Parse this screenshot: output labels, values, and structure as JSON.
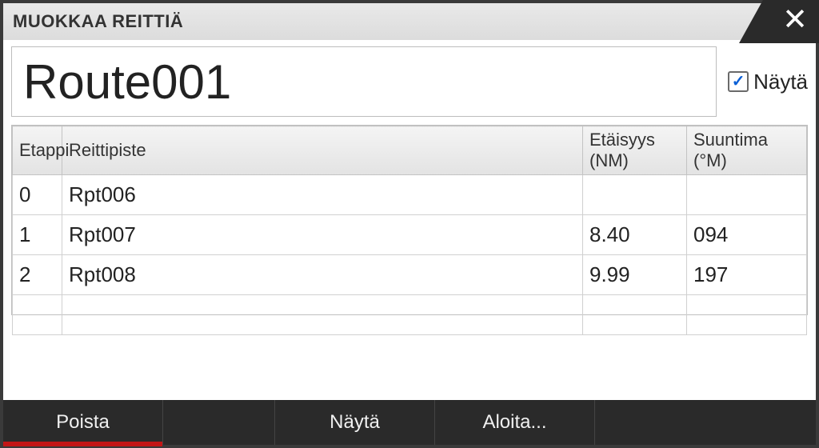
{
  "window": {
    "title": "MUOKKAA REITTIÄ"
  },
  "route": {
    "name": "Route001",
    "show_label": "Näytä",
    "show_checked": true
  },
  "table": {
    "headers": {
      "leg": "Etappi",
      "waypoint": "Reittipiste",
      "distance": "Etäisyys (NM)",
      "bearing": "Suuntima (°M)"
    },
    "rows": [
      {
        "leg": "0",
        "waypoint": "Rpt006",
        "distance": "",
        "bearing": ""
      },
      {
        "leg": "1",
        "waypoint": "Rpt007",
        "distance": "8.40",
        "bearing": "094"
      },
      {
        "leg": "2",
        "waypoint": "Rpt008",
        "distance": "9.99",
        "bearing": "197"
      }
    ]
  },
  "footer": {
    "delete": "Poista",
    "show": "Näytä",
    "start": "Aloita..."
  }
}
